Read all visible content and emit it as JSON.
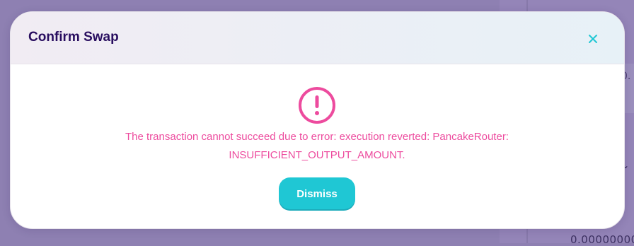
{
  "background": {
    "panel_value_fragment": "0.",
    "panel_amount_fragment": "0.00000000",
    "chevron_icon": "chevron-down-icon"
  },
  "modal": {
    "title": "Confirm Swap",
    "close_icon": "close-icon",
    "warning_icon": "error-circle-icon",
    "error_message": "The transaction cannot succeed due to error: execution reverted: PancakeRouter: INSUFFICIENT_OUTPUT_AMOUNT.",
    "dismiss_label": "Dismiss"
  },
  "colors": {
    "overlay": "#8e80b2",
    "title": "#280d5f",
    "accent": "#1fc7d4",
    "error": "#ed4b9e"
  }
}
